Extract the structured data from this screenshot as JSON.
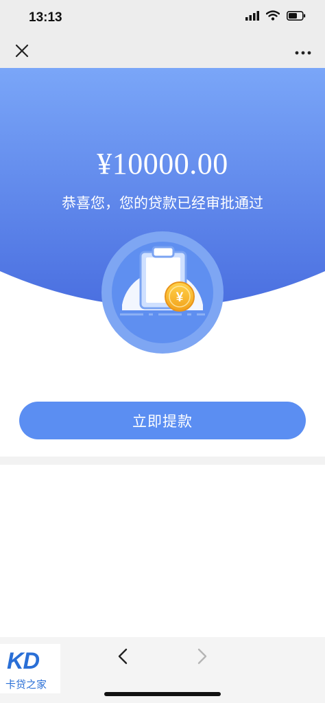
{
  "status_bar": {
    "time": "13:13",
    "icons": [
      "signal-icon",
      "wifi-icon",
      "battery-icon"
    ]
  },
  "nav_bar": {
    "close_icon": "close-icon",
    "more_icon": "more-icon"
  },
  "hero": {
    "amount": "¥10000.00",
    "message": "恭喜您，您的贷款已经审批通过",
    "coin_symbol": "¥",
    "gradient_top": "#7aa6f8",
    "gradient_bottom": "#4a6fe0"
  },
  "actions": {
    "withdraw_label": "立即提款",
    "accent": "#5b8ef2"
  },
  "bottom_nav": {
    "back_icon": "chevron-left-icon",
    "forward_icon": "chevron-right-icon"
  },
  "watermark": {
    "logo": "KD",
    "text": "卡贷之家"
  }
}
